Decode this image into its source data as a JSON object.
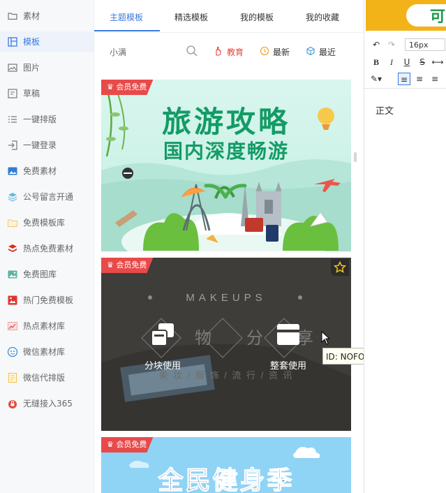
{
  "sidebar": {
    "items": [
      {
        "label": "素材",
        "icon": "folder-icon"
      },
      {
        "label": "模板",
        "icon": "layout-icon"
      },
      {
        "label": "图片",
        "icon": "image-icon"
      },
      {
        "label": "草稿",
        "icon": "draft-icon"
      },
      {
        "label": "一键排版",
        "icon": "list-icon"
      },
      {
        "label": "一键登录",
        "icon": "login-icon"
      },
      {
        "label": "免费素材",
        "icon": "photo-icon"
      },
      {
        "label": "公号留言开通",
        "icon": "layers-icon"
      },
      {
        "label": "免费模板库",
        "icon": "folder-icon"
      },
      {
        "label": "热点免费素材",
        "icon": "stack-icon"
      },
      {
        "label": "免费图库",
        "icon": "gallery-icon"
      },
      {
        "label": "热门免费模板",
        "icon": "hot-template-icon"
      },
      {
        "label": "热点素材库",
        "icon": "chart-icon"
      },
      {
        "label": "微信素材库",
        "icon": "wechat-icon"
      },
      {
        "label": "微信代排版",
        "icon": "doc-icon"
      },
      {
        "label": "无缝接入365",
        "icon": "lock-icon"
      }
    ]
  },
  "tabs": [
    "主题模板",
    "精选模板",
    "我的模板",
    "我的收藏"
  ],
  "filter": {
    "search_text": "小满",
    "chips": [
      "教育",
      "最新",
      "最近"
    ]
  },
  "cards": [
    {
      "badge": "会员免费",
      "title": "旅游攻略",
      "subtitle": "国内深度畅游"
    },
    {
      "badge": "会员免费",
      "bg_title": "MAKEUPS",
      "bg_chars": [
        "物",
        "分",
        "享"
      ],
      "bg_line": "美 妆 / 服 饰 / 流 行 / 资 讯",
      "btn_left": "分块使用",
      "btn_right": "整套使用"
    },
    {
      "badge": "会员免费",
      "title": "全民健身季"
    }
  ],
  "tooltip": "ID: NOFODhFJJi, 好物分享,简",
  "editor": {
    "banner_text": "可",
    "font_size": "16px",
    "body_text": "正文"
  },
  "colors": {
    "accent": "#3a7be0",
    "badge": "#e84a4a",
    "banner": "#f2b319"
  }
}
